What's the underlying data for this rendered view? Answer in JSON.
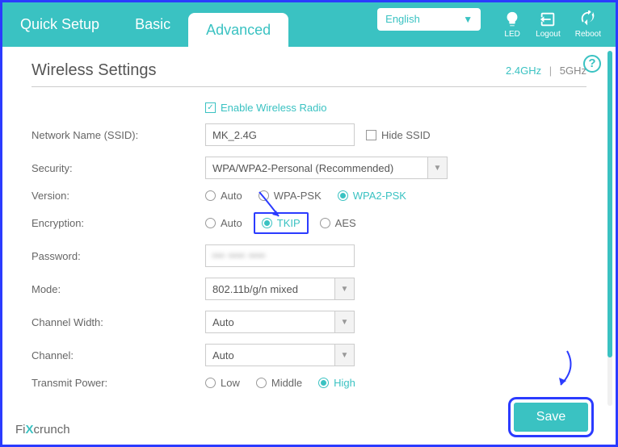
{
  "header": {
    "tabs": {
      "quick_setup": "Quick Setup",
      "basic": "Basic",
      "advanced": "Advanced"
    },
    "language": "English",
    "icons": {
      "led": "LED",
      "logout": "Logout",
      "reboot": "Reboot"
    }
  },
  "page": {
    "title": "Wireless Settings",
    "band_active": "2.4GHz",
    "band_sep": "|",
    "band_inactive": "5GHz"
  },
  "form": {
    "enable_label": "Enable Wireless Radio",
    "ssid_label": "Network Name (SSID):",
    "ssid_value": "MK_2.4G",
    "hide_ssid": "Hide SSID",
    "security_label": "Security:",
    "security_value": "WPA/WPA2-Personal (Recommended)",
    "version_label": "Version:",
    "version_options": {
      "auto": "Auto",
      "wpapsk": "WPA-PSK",
      "wpa2psk": "WPA2-PSK"
    },
    "encryption_label": "Encryption:",
    "encryption_options": {
      "auto": "Auto",
      "tkip": "TKIP",
      "aes": "AES"
    },
    "password_label": "Password:",
    "mode_label": "Mode:",
    "mode_value": "802.11b/g/n mixed",
    "channel_width_label": "Channel Width:",
    "channel_width_value": "Auto",
    "channel_label": "Channel:",
    "channel_value": "Auto",
    "transmit_label": "Transmit Power:",
    "transmit_options": {
      "low": "Low",
      "middle": "Middle",
      "high": "High"
    }
  },
  "buttons": {
    "save": "Save"
  },
  "watermark": {
    "fi": "Fi",
    "x": "X",
    "crunch": "crunch"
  }
}
